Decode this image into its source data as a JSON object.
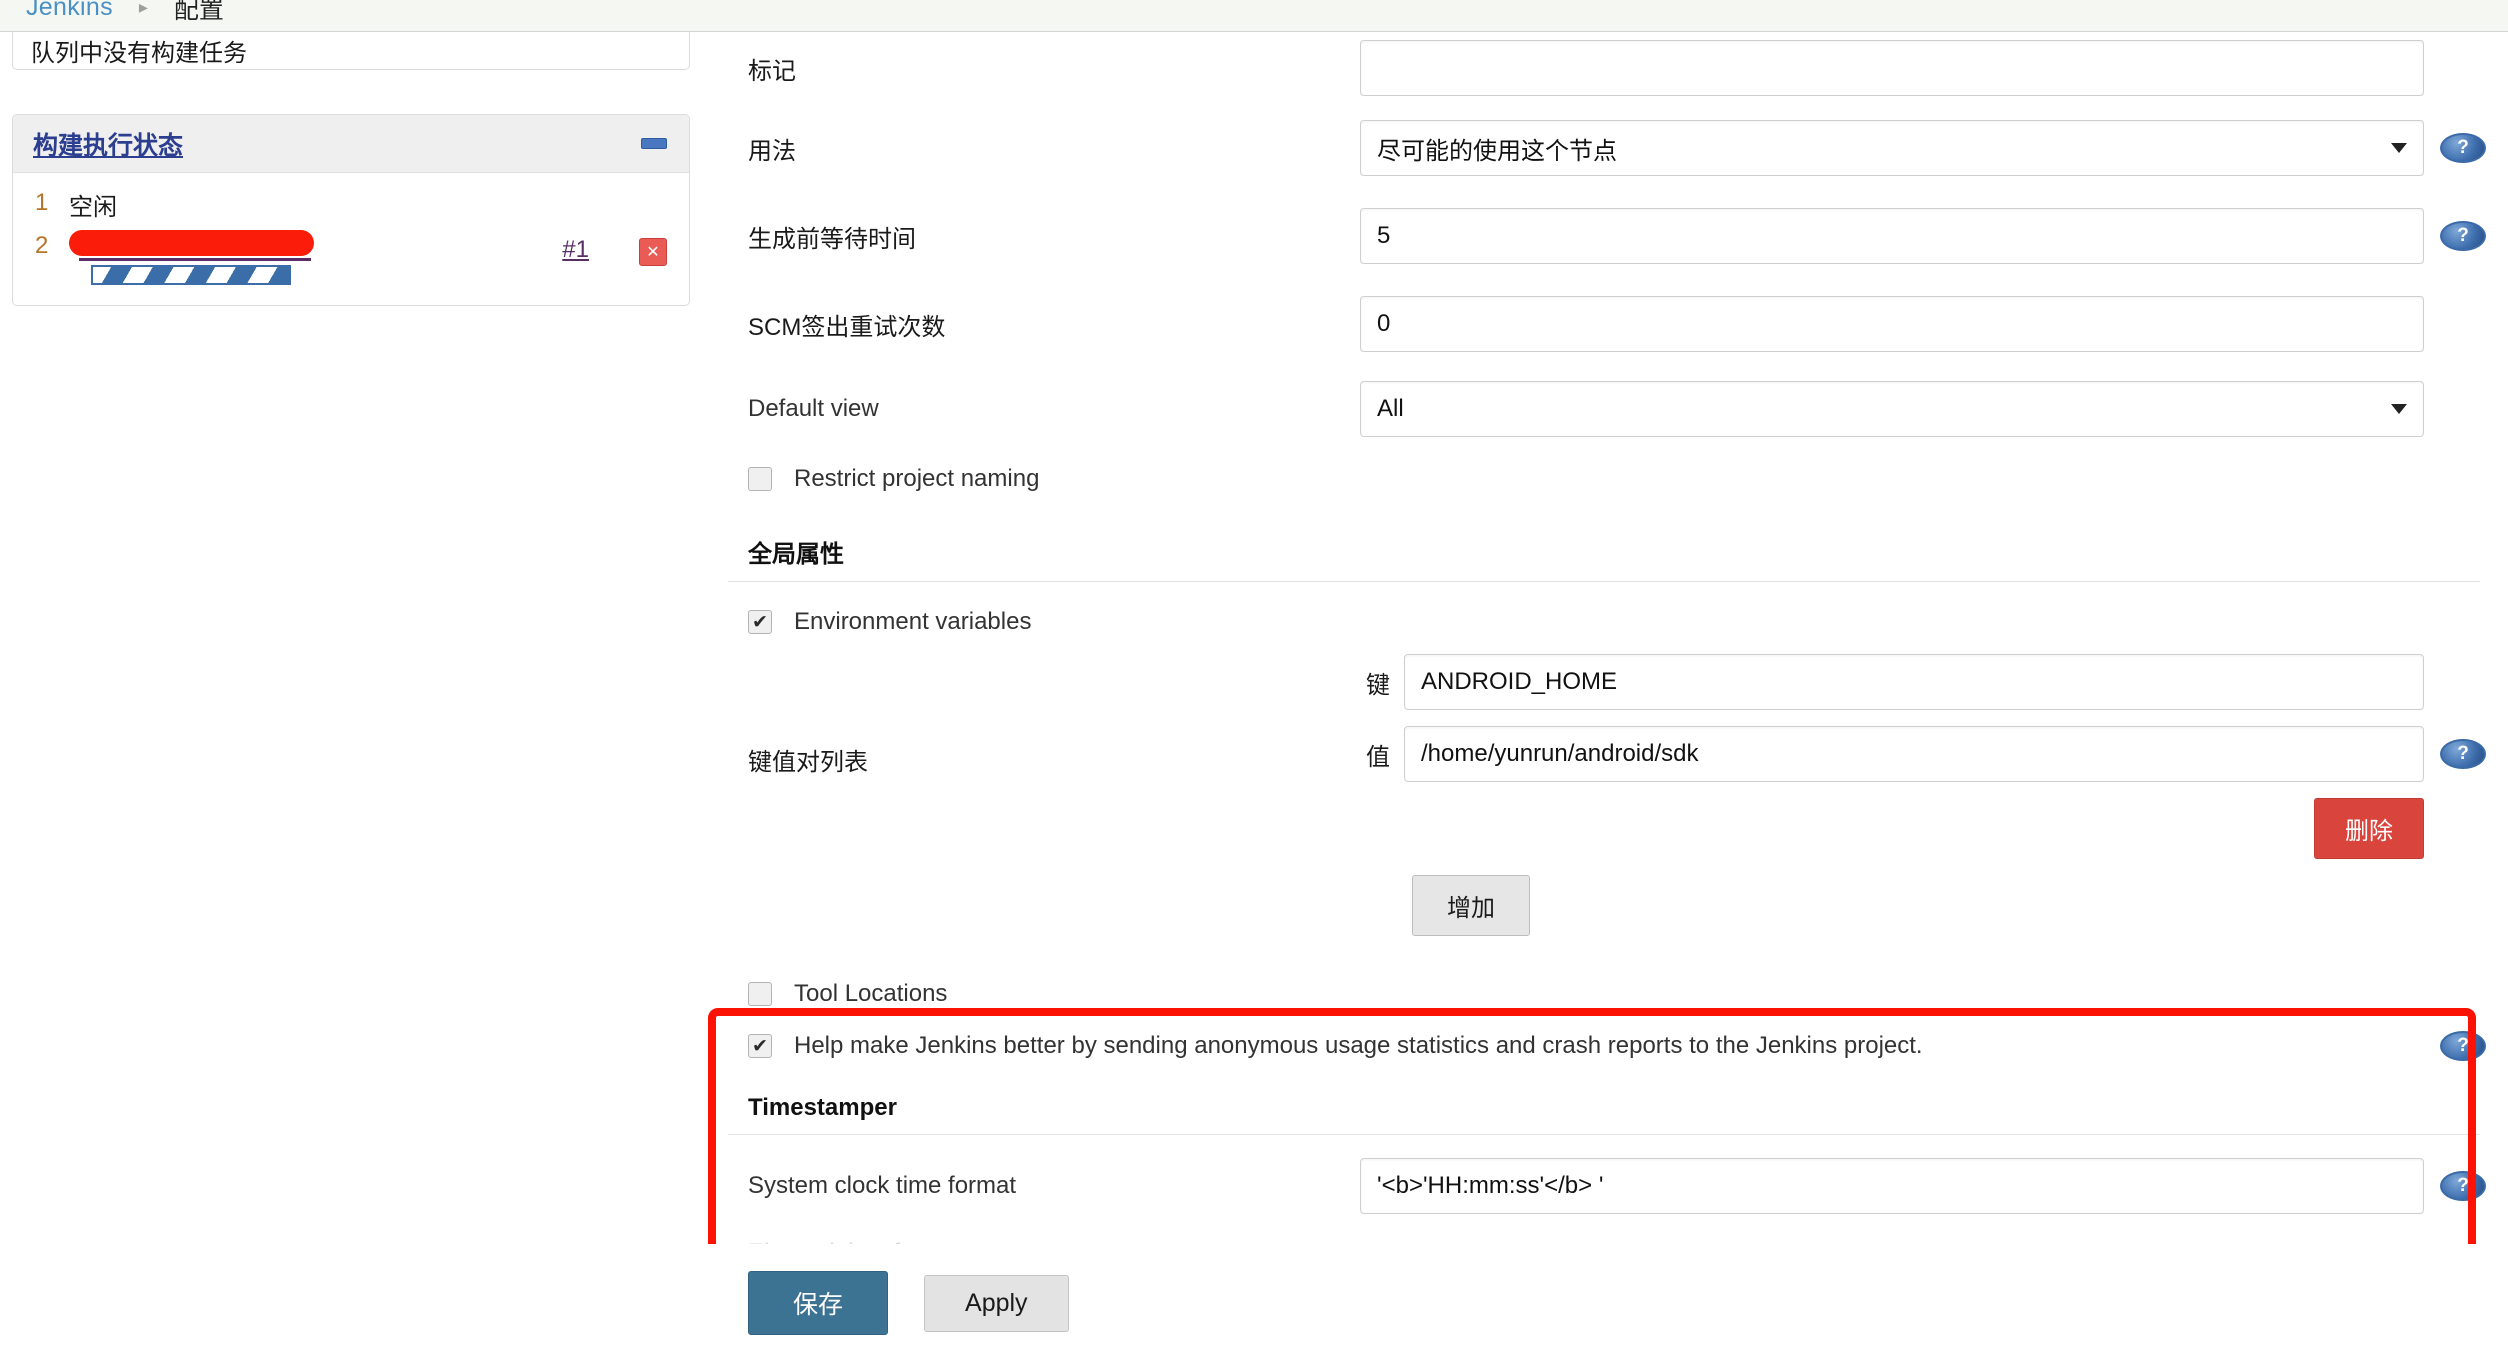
{
  "breadcrumb": {
    "root": "Jenkins",
    "separator": "▸",
    "current": "配置"
  },
  "sidebar": {
    "queue_message": "队列中没有构建任务",
    "executors": {
      "title": "构建执行状态",
      "collapse_icon": "minus-icon",
      "rows": [
        {
          "num": "1",
          "status": "空闲",
          "redacted": false,
          "build": "",
          "stop_icon": ""
        },
        {
          "num": "2",
          "status": "",
          "redacted": true,
          "build": "#1",
          "stop_icon": "✕"
        }
      ]
    }
  },
  "form": {
    "fields": [
      {
        "label": "标记",
        "type": "text",
        "value": "",
        "help": false
      },
      {
        "label": "用法",
        "type": "select",
        "value": "尽可能的使用这个节点",
        "help": true
      },
      {
        "label": "生成前等待时间",
        "type": "text",
        "value": "5",
        "help": true
      },
      {
        "label": "SCM签出重试次数",
        "type": "text",
        "value": "0",
        "help": false
      },
      {
        "label": "Default view",
        "type": "select",
        "value": "All",
        "help": false
      }
    ],
    "restrict_project_naming": {
      "label": "Restrict project naming",
      "checked": false
    },
    "global_properties": {
      "title": "全局属性",
      "environment_variables": {
        "label": "Environment variables",
        "checked": true
      },
      "kv_list_label": "键值对列表",
      "key_tag": "键",
      "key_value": "ANDROID_HOME",
      "value_tag": "值",
      "value_value": "/home/yunrun/android/sdk",
      "delete_label": "删除",
      "add_label": "增加"
    },
    "tool_locations": {
      "label": "Tool Locations",
      "checked": false
    },
    "usage_stats": {
      "label": "Help make Jenkins better by sending anonymous usage statistics and crash reports to the Jenkins project.",
      "checked": true
    },
    "timestamper": {
      "title": "Timestamper",
      "system_clock_label": "System clock time format",
      "system_clock_value": "'<b>'HH:mm:ss'</b> '",
      "elapsed_label": "Elapsed time format"
    }
  },
  "footer": {
    "save_label": "保存",
    "apply_label": "Apply"
  },
  "icons": {
    "help": "?",
    "caret_down": "▼",
    "check": "✔"
  },
  "colors": {
    "highlight": "#fb1205",
    "save_button": "#3d7392",
    "delete_button": "#d9453d",
    "link": "#2c3e8f",
    "progress": "#3b6ea8"
  }
}
